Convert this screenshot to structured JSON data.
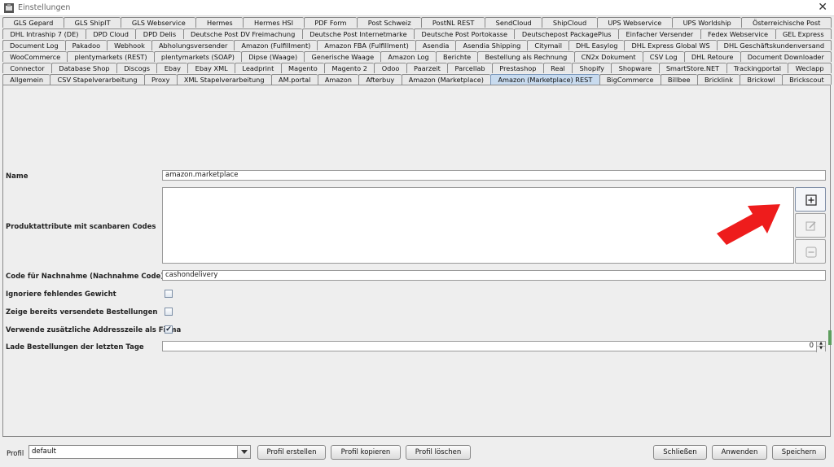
{
  "window": {
    "title": "Einstellungen",
    "close_glyph": "✕"
  },
  "tab_rows": [
    [
      "GLS Gepard",
      "GLS ShipIT",
      "GLS Webservice",
      "Hermes",
      "Hermes HSI",
      "PDF Form",
      "Post Schweiz",
      "PostNL REST",
      "SendCloud",
      "ShipCloud",
      "UPS Webservice",
      "UPS Worldship",
      "Österreichische Post"
    ],
    [
      "DHL Intraship 7 (DE)",
      "DPD Cloud",
      "DPD Delis",
      "Deutsche Post DV Freimachung",
      "Deutsche Post Internetmarke",
      "Deutsche Post Portokasse",
      "Deutschepost PackagePlus",
      "Einfacher Versender",
      "Fedex Webservice",
      "GEL Express"
    ],
    [
      "Document Log",
      "Pakadoo",
      "Webhook",
      "Abholungsversender",
      "Amazon (Fulfillment)",
      "Amazon FBA (Fulfillment)",
      "Asendia",
      "Asendia Shipping",
      "Citymail",
      "DHL Easylog",
      "DHL Express Global WS",
      "DHL Geschäftskundenversand"
    ],
    [
      "WooCommerce",
      "plentymarkets (REST)",
      "plentymarkets (SOAP)",
      "Dipse (Waage)",
      "Generische Waage",
      "Amazon Log",
      "Berichte",
      "Bestellung als Rechnung",
      "CN2x Dokument",
      "CSV Log",
      "DHL Retoure",
      "Document Downloader"
    ],
    [
      "Connector",
      "Database Shop",
      "Discogs",
      "Ebay",
      "Ebay XML",
      "Leadprint",
      "Magento",
      "Magento 2",
      "Odoo",
      "Paarzeit",
      "Parcellab",
      "Prestashop",
      "Real",
      "Shopify",
      "Shopware",
      "SmartStore.NET",
      "Trackingportal",
      "Weclapp"
    ],
    [
      "Allgemein",
      "CSV Stapelverarbeitung",
      "Proxy",
      "XML Stapelverarbeitung",
      "AM.portal",
      "Amazon",
      "Afterbuy",
      "Amazon (Marketplace)",
      "Amazon (Marketplace) REST",
      "BigCommerce",
      "Billbee",
      "Bricklink",
      "Brickowl",
      "Brickscout"
    ]
  ],
  "active_tab": "Amazon (Marketplace) REST",
  "form": {
    "name_label": "Name",
    "name_value": "amazon.marketplace",
    "codes_label": "Produktattribute mit scanbaren Codes",
    "cod_label": "Code für Nachnahme (Nachnahme Code)",
    "cod_value": "cashondelivery",
    "ignore_weight_label": "Ignoriere fehlendes Gewicht",
    "ignore_weight_checked": false,
    "show_shipped_label": "Zeige bereits versendete Bestellungen",
    "show_shipped_checked": false,
    "address_line_label": "Verwende zusätzliche Addresszeile als Firma",
    "address_line_checked": true,
    "load_days_label": "Lade Bestellungen der letzten Tage",
    "load_days_value": "0"
  },
  "list_buttons": [
    "add-icon",
    "edit-icon",
    "remove-icon"
  ],
  "annotation_color": "#ee1c1c",
  "bottom": {
    "profile_label": "Profil",
    "profile_value": "default",
    "create_profile": "Profil erstellen",
    "copy_profile": "Profil kopieren",
    "delete_profile": "Profil löschen",
    "close": "Schließen",
    "apply": "Anwenden",
    "save": "Speichern"
  }
}
